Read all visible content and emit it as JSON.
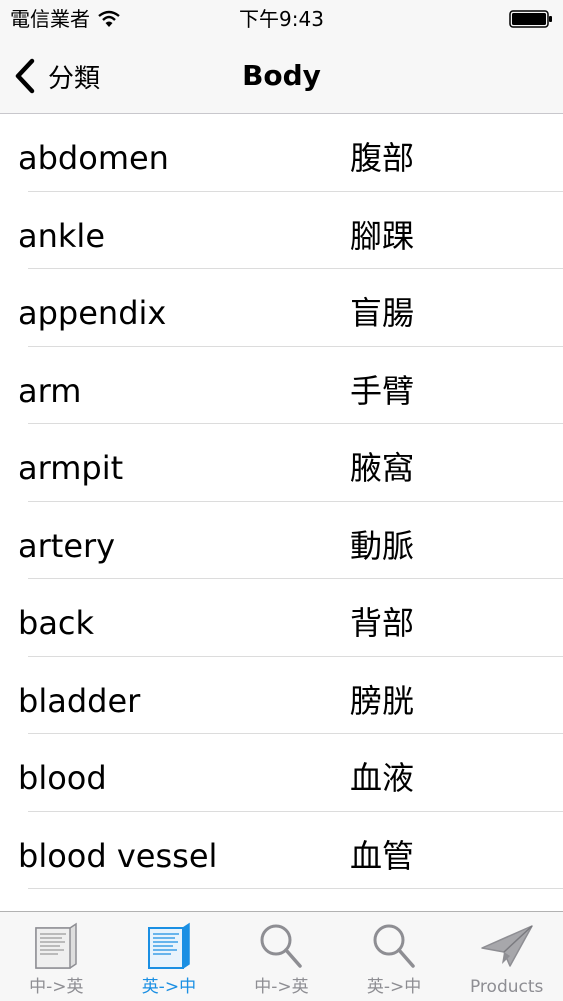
{
  "status_bar": {
    "carrier": "電信業者",
    "time": "下午9:43"
  },
  "nav": {
    "back_label": "分類",
    "title": "Body"
  },
  "words": [
    {
      "en": "abdomen",
      "zh": "腹部"
    },
    {
      "en": "ankle",
      "zh": "腳踝"
    },
    {
      "en": "appendix",
      "zh": "盲腸"
    },
    {
      "en": "arm",
      "zh": "手臂"
    },
    {
      "en": "armpit",
      "zh": "腋窩"
    },
    {
      "en": "artery",
      "zh": "動脈"
    },
    {
      "en": "back",
      "zh": "背部"
    },
    {
      "en": "bladder",
      "zh": "膀胱"
    },
    {
      "en": "blood",
      "zh": "血液"
    },
    {
      "en": "blood vessel",
      "zh": "血管"
    }
  ],
  "tabs": [
    {
      "label": "中->英",
      "icon": "book-icon",
      "active": false
    },
    {
      "label": "英->中",
      "icon": "book-icon",
      "active": true
    },
    {
      "label": "中->英",
      "icon": "search-icon",
      "active": false
    },
    {
      "label": "英->中",
      "icon": "search-icon",
      "active": false
    },
    {
      "label": "Products",
      "icon": "paper-plane-icon",
      "active": false
    }
  ],
  "colors": {
    "active_tab": "#1a8fe3",
    "inactive_tab": "#8e8e93",
    "bar_background": "#f7f7f7"
  }
}
